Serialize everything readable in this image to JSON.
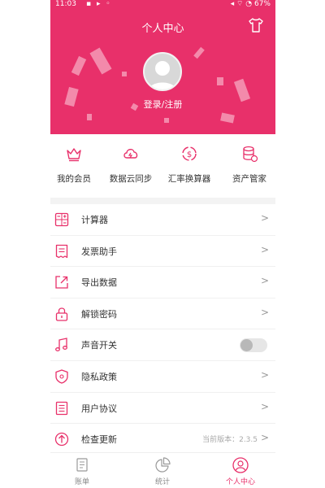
{
  "statusbar": {
    "time": "11:03",
    "battery": "67%"
  },
  "header": {
    "title": "个人中心",
    "login_text": "登录/注册"
  },
  "quick_actions": [
    {
      "label": "我的会员",
      "icon": "crown-icon"
    },
    {
      "label": "数据云同步",
      "icon": "cloud-sync-icon"
    },
    {
      "label": "汇率换算器",
      "icon": "currency-exchange-icon"
    },
    {
      "label": "资产管家",
      "icon": "asset-database-icon"
    }
  ],
  "menu": {
    "calculator": "计算器",
    "invoice": "发票助手",
    "export": "导出数据",
    "unlock": "解锁密码",
    "sound": "声音开关",
    "privacy": "隐私政策",
    "agreement": "用户协议",
    "update": "检查更新",
    "version": "当前版本：2.3.5",
    "chevron": ">"
  },
  "sound_enabled": false,
  "tabs": [
    {
      "label": "账单"
    },
    {
      "label": "统计"
    },
    {
      "label": "个人中心"
    }
  ],
  "colors": {
    "accent": "#e8306a",
    "header_bg": "#e8306a",
    "divider": "#f3f3f3"
  }
}
